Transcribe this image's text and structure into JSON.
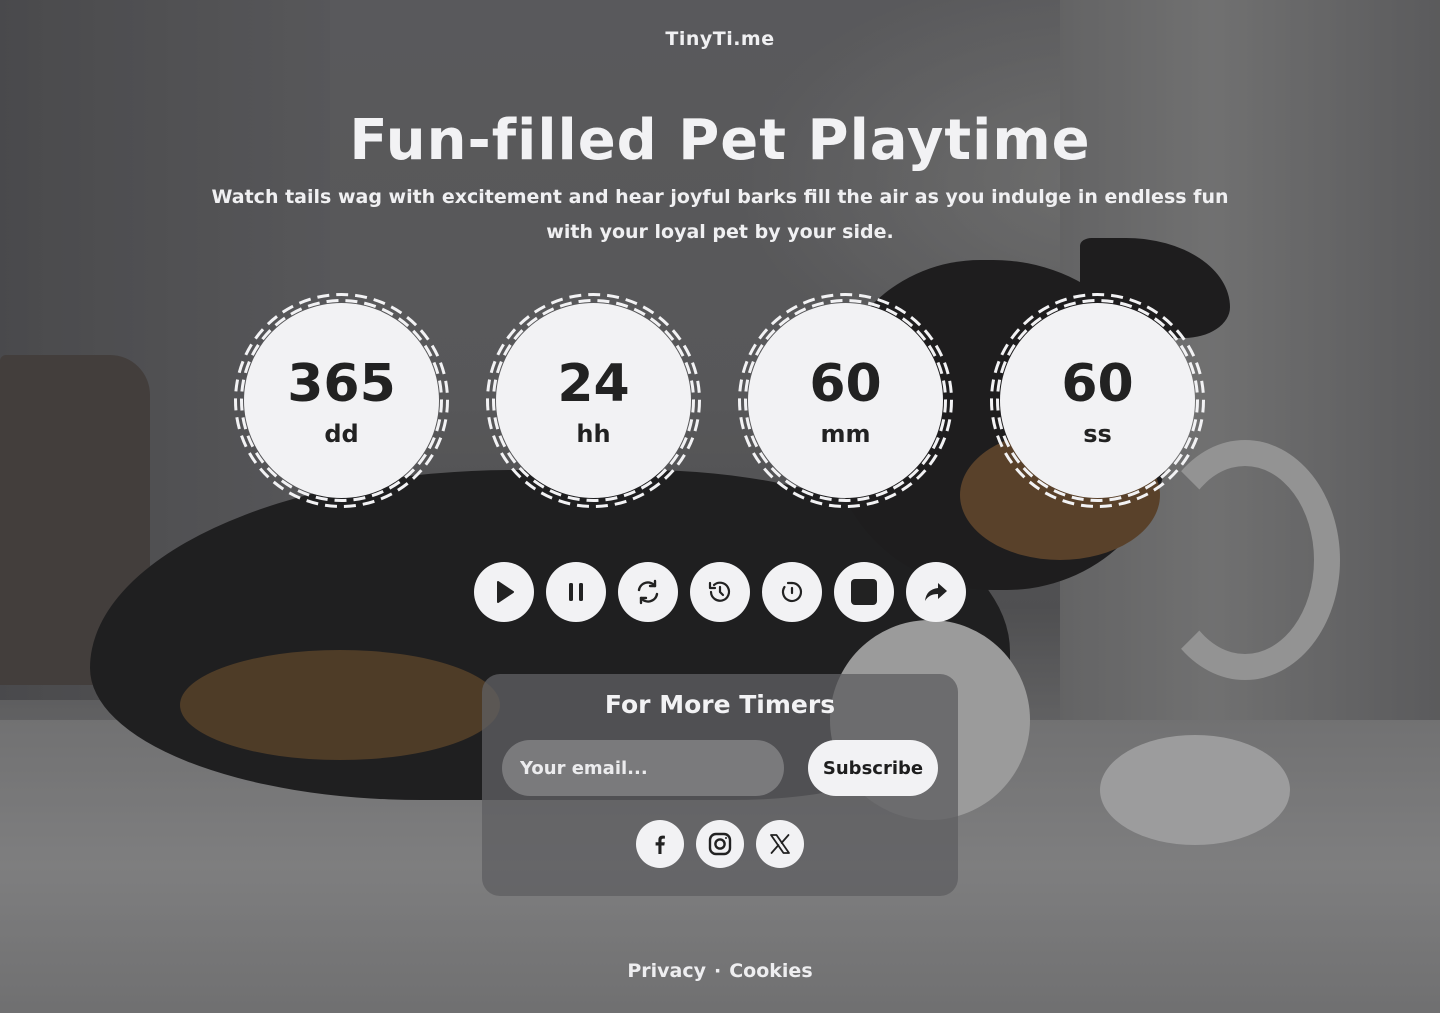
{
  "brand": "TinyTi.me",
  "hero": {
    "title": "Fun-filled Pet Playtime",
    "subtitle": "Watch tails wag with excitement and hear joyful barks fill the air as you indulge in endless fun with your loyal pet by your side."
  },
  "timers": [
    {
      "value": "365",
      "unit": "dd"
    },
    {
      "value": "24",
      "unit": "hh"
    },
    {
      "value": "60",
      "unit": "mm"
    },
    {
      "value": "60",
      "unit": "ss"
    }
  ],
  "controls": [
    {
      "name": "play-button",
      "icon": "play-icon"
    },
    {
      "name": "pause-button",
      "icon": "pause-icon"
    },
    {
      "name": "restart-button",
      "icon": "refresh-icon"
    },
    {
      "name": "history-button",
      "icon": "history-icon"
    },
    {
      "name": "timer-reset-button",
      "icon": "timer-icon"
    },
    {
      "name": "stop-button",
      "icon": "stop-icon"
    },
    {
      "name": "share-button",
      "icon": "share-icon"
    }
  ],
  "subscribe": {
    "title": "For More Timers",
    "email_placeholder": "Your email...",
    "button_label": "Subscribe"
  },
  "social": [
    "facebook-icon",
    "instagram-icon",
    "x-icon"
  ],
  "footer": {
    "privacy": "Privacy",
    "separator": "·",
    "cookies": "Cookies"
  },
  "colors": {
    "surface": "#f2f2f4",
    "text_dark": "#222222",
    "panel": "#5f5f62"
  }
}
